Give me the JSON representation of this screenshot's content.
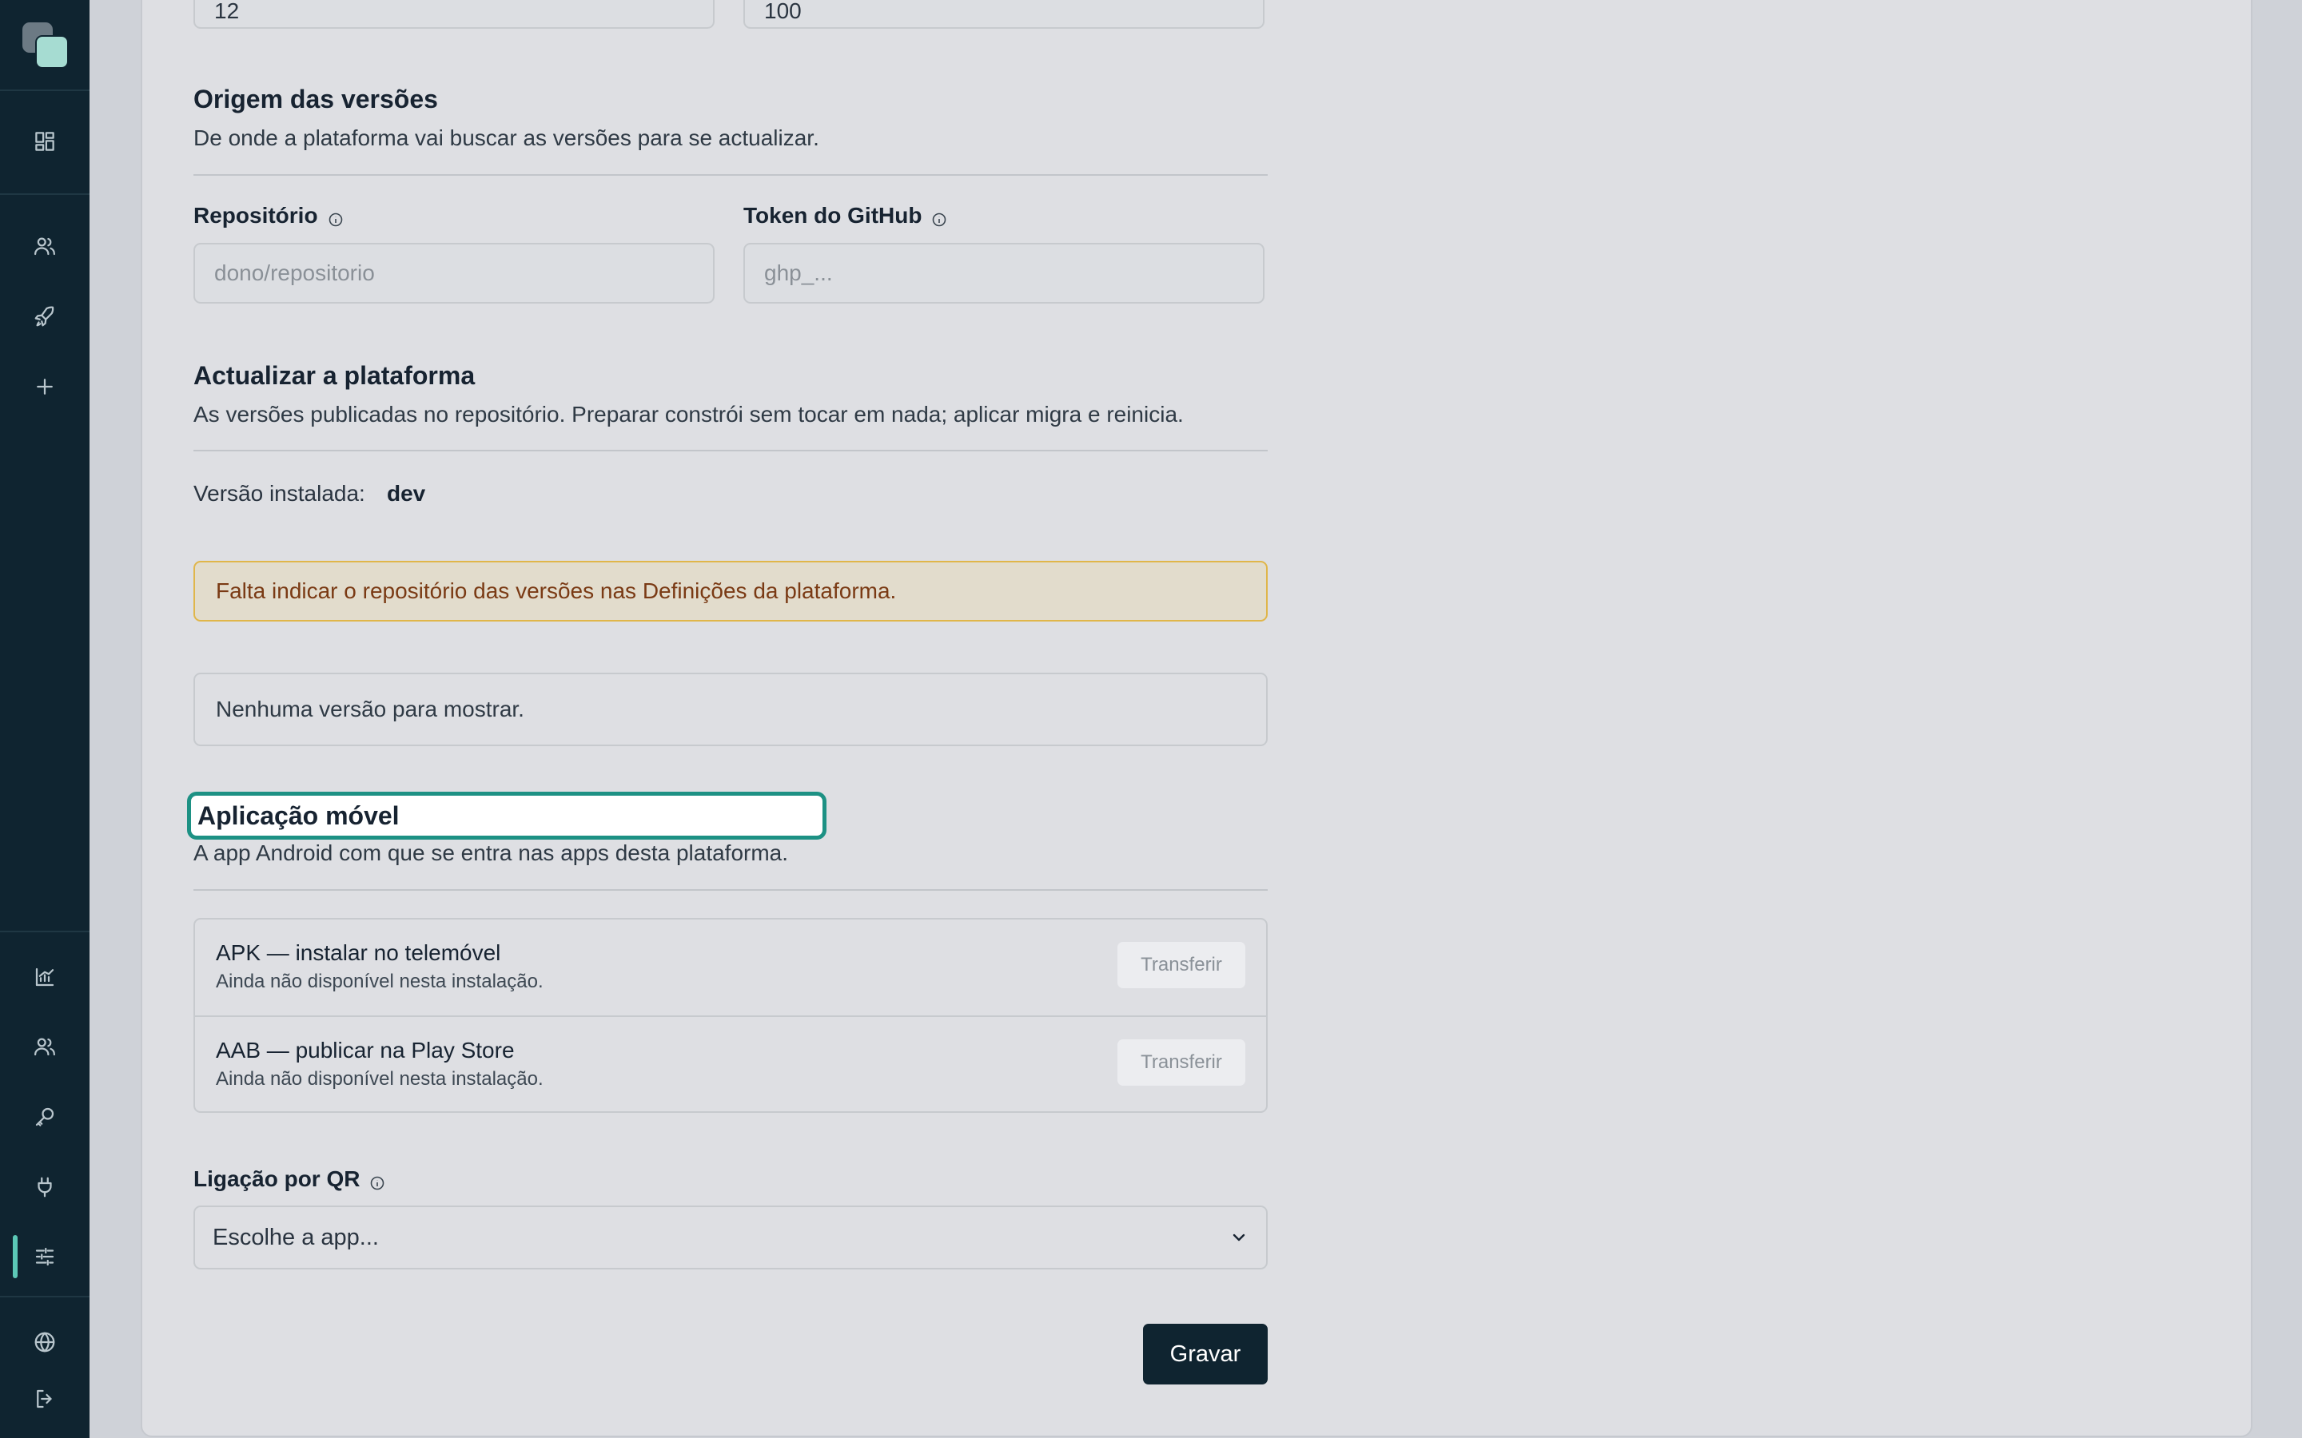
{
  "top_inputs": {
    "left_value": "12",
    "right_value": "100"
  },
  "versions_origin": {
    "title": "Origem das versões",
    "description": "De onde a plataforma vai buscar as versões para se actualizar.",
    "repo_label": "Repositório",
    "repo_placeholder": "dono/repositorio",
    "token_label": "Token do GitHub",
    "token_placeholder": "ghp_..."
  },
  "update_platform": {
    "title": "Actualizar a plataforma",
    "description": "As versões publicadas no repositório. Preparar constrói sem tocar em nada; aplicar migra e reinicia.",
    "installed_label": "Versão instalada:",
    "installed_value": "dev",
    "warning": "Falta indicar o repositório das versões nas Definições da plataforma.",
    "empty": "Nenhuma versão para mostrar."
  },
  "mobile_app": {
    "title": "Aplicação móvel",
    "description": "A app Android com que se entra nas apps desta plataforma.",
    "items": [
      {
        "name": "APK — instalar no telemóvel",
        "status": "Ainda não disponível nesta instalação.",
        "button": "Transferir"
      },
      {
        "name": "AAB — publicar na Play Store",
        "status": "Ainda não disponível nesta instalação.",
        "button": "Transferir"
      }
    ],
    "qr_label": "Ligação por QR",
    "qr_select_value": "Escolhe a app..."
  },
  "save_label": "Gravar",
  "sidebar": {
    "top_icons": [
      "dashboard-icon",
      "users-icon",
      "rocket-icon",
      "plus-icon"
    ],
    "bottom_icons": [
      "chart-icon",
      "team-icon",
      "key-icon",
      "plug-icon",
      "sliders-icon",
      "globe-icon",
      "logout-icon"
    ],
    "active": "sliders-icon"
  },
  "colors": {
    "sidebar": "#0f2430",
    "accent": "#1d9184",
    "warning_border": "#e0b64a",
    "warning_text": "#7a3a14"
  }
}
